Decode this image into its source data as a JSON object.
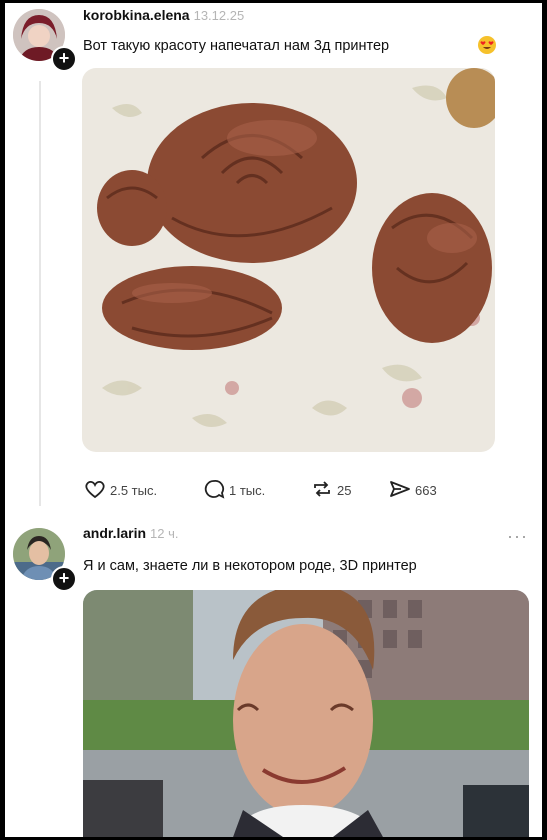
{
  "posts": [
    {
      "username": "korobkina.elena",
      "meta": "13.12.25",
      "text": "Вот такую красоту напечатал нам 3д принтер",
      "image_desc": "rose-bread-photo",
      "actions": {
        "likes": "2.5 тыс.",
        "comments": "1 тыс.",
        "reposts": "25",
        "shares": "663"
      }
    },
    {
      "username": "andr.larin",
      "meta": "12 ч.",
      "text": "Я и сам, знаете ли в некотором роде, 3D принтер",
      "image_desc": "smiling-man-photo"
    }
  ],
  "more_label": "···"
}
